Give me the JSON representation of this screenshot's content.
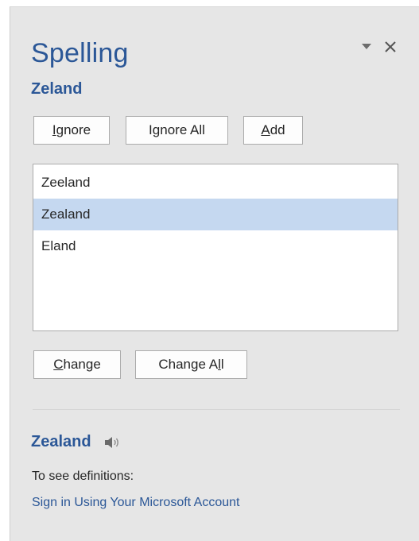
{
  "pane": {
    "title": "Spelling",
    "menu_icon": "dropdown-arrow-icon",
    "close_icon": "close-icon"
  },
  "misspelled_word": "Zeland",
  "actions": {
    "ignore": {
      "before": "",
      "key": "I",
      "after": "gnore"
    },
    "ignore_all": {
      "before": "I",
      "key": "g",
      "after": "nore All"
    },
    "add": {
      "before": "",
      "key": "A",
      "after": "dd"
    }
  },
  "suggestions": {
    "items": [
      "Zeeland",
      "Zealand",
      "Eland"
    ],
    "selected": "Zealand"
  },
  "change_actions": {
    "change": {
      "before": "",
      "key": "C",
      "after": "hange"
    },
    "change_all": {
      "before": "Change A",
      "key": "l",
      "after": "l"
    }
  },
  "definition": {
    "word": "Zealand",
    "audio_icon": "speaker-icon",
    "note": "To see definitions:",
    "sign_in_link": "Sign in Using Your Microsoft Account"
  },
  "colors": {
    "accent": "#2b5797",
    "pane_bg": "#e6e6e6",
    "selection": "#c5d8f0"
  }
}
